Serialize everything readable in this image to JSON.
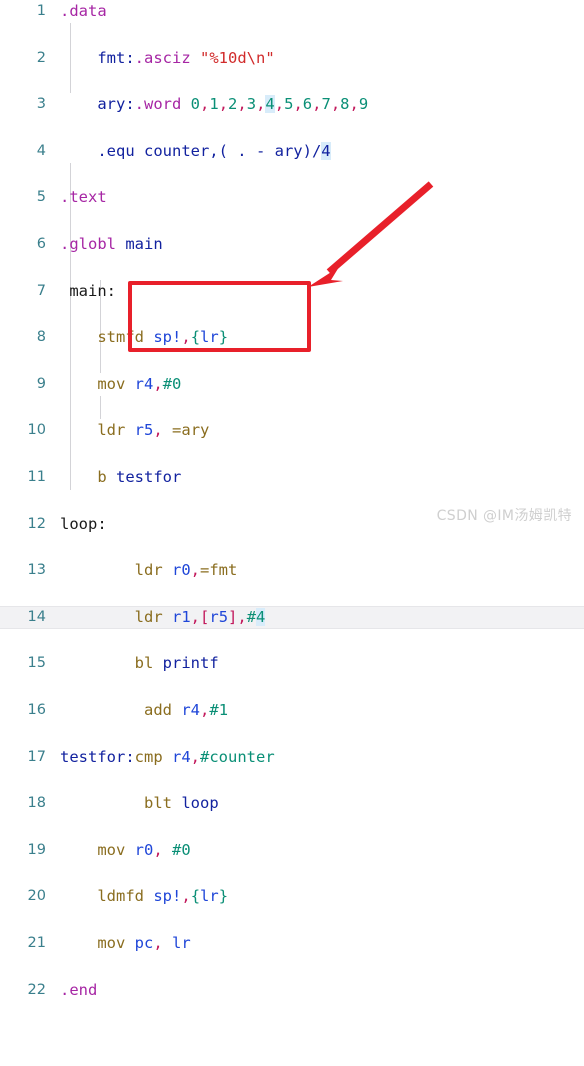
{
  "editor": {
    "language": "arm-assembly",
    "current_line": 14,
    "colors": {
      "background": "#ffffff",
      "gutter_text": "#3a7f8c",
      "directive": "#a626a4",
      "label": "#12229f",
      "mnemonic": "#8a6d1f",
      "register": "#1f46d8",
      "number": "#0a8f76",
      "string": "#d12b2b",
      "punctuation": "#c2185b",
      "match_highlight": "#d8ecfa",
      "current_line_bg": "#f2f2f4",
      "indent_guide": "#d3d3d7",
      "annotation_red": "#e8202a",
      "watermark": "#cfcfcf"
    },
    "lines": [
      {
        "n": "1",
        "text": ".data"
      },
      {
        "n": "2",
        "text": "    fmt:.asciz \"%10d\\n\""
      },
      {
        "n": "3",
        "text": "    ary:.word 0,1,2,3,4,5,6,7,8,9"
      },
      {
        "n": "4",
        "text": "    .equ counter,( . - ary)/4"
      },
      {
        "n": "5",
        "text": ".text"
      },
      {
        "n": "6",
        "text": ".globl main"
      },
      {
        "n": "7",
        "text": " main:"
      },
      {
        "n": "8",
        "text": "    stmfd sp!,{lr}"
      },
      {
        "n": "9",
        "text": "    mov r4,#0"
      },
      {
        "n": "10",
        "text": "    ldr r5, =ary"
      },
      {
        "n": "11",
        "text": "    b testfor"
      },
      {
        "n": "12",
        "text": "loop:"
      },
      {
        "n": "13",
        "text": "        ldr r0,=fmt"
      },
      {
        "n": "14",
        "text": "        ldr r1,[r5],#4"
      },
      {
        "n": "15",
        "text": "        bl printf"
      },
      {
        "n": "16",
        "text": "         add r4,#1"
      },
      {
        "n": "17",
        "text": "testfor:cmp r4,#counter"
      },
      {
        "n": "18",
        "text": "         blt loop"
      },
      {
        "n": "19",
        "text": "    mov r0, #0"
      },
      {
        "n": "20",
        "text": "    ldmfd sp!,{lr}"
      },
      {
        "n": "21",
        "text": "    mov pc, lr"
      },
      {
        "n": "22",
        "text": ".end"
      }
    ]
  },
  "annotations": {
    "box_label": "highlighted-loop-body",
    "arrow_label": "pointer-to-loop-body"
  },
  "watermark": {
    "text": "CSDN @IM汤姆凯特"
  }
}
